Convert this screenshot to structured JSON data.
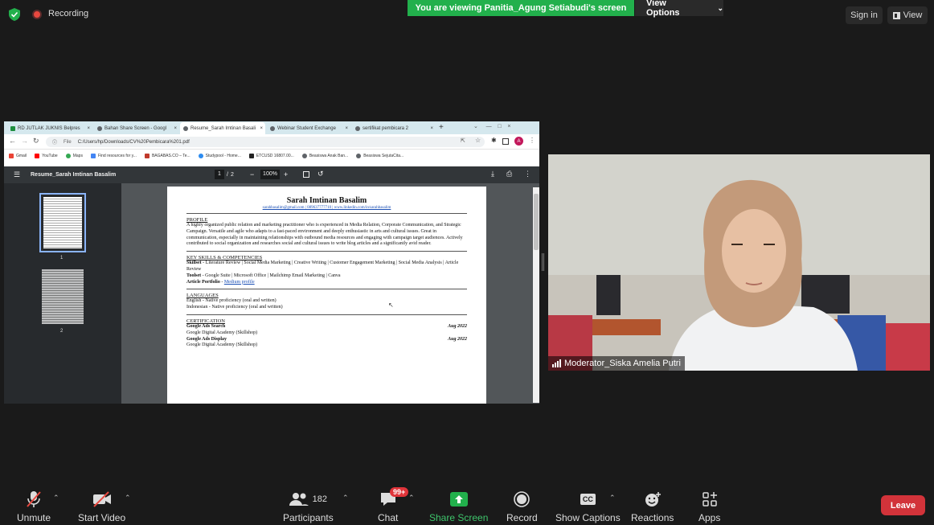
{
  "top": {
    "recording_label": "Recording",
    "viewing_banner": "You are viewing Panitia_Agung Setiabudi's screen",
    "view_options_label": "View Options",
    "sign_in_label": "Sign in",
    "view_label": "View"
  },
  "browser": {
    "tabs": [
      {
        "label": "RD JUTLAK JUKNIS Belpres",
        "color": "#1e8e3e"
      },
      {
        "label": "Bahan Share Screen - Googl",
        "color": "#5f6368"
      },
      {
        "label": "Resume_Sarah Imtinan Basali",
        "color": "#5f6368"
      },
      {
        "label": "Webinar Student Exchange",
        "color": "#5f6368"
      },
      {
        "label": "sertifikat pembicara 2",
        "color": "#5f6368"
      }
    ],
    "new_tab": "+",
    "file_label": "File",
    "url": "C:/Users/hp/Downloads/CV%20Pembicara%201.pdf",
    "profile_initial": "A",
    "bookmarks": [
      {
        "label": "Gmail",
        "color": "#ea4335"
      },
      {
        "label": "YouTube",
        "color": "#ff0000"
      },
      {
        "label": "Maps",
        "color": "#34a853"
      },
      {
        "label": "Find resources for y...",
        "color": "#4285f4"
      },
      {
        "label": "BAGABAS.CO – Te...",
        "color": "#c0392b"
      },
      {
        "label": "Studypool - Home...",
        "color": "#2d8cf0"
      },
      {
        "label": "ETCUSD 16807.00...",
        "color": "#222222"
      },
      {
        "label": "Beasiswa Anak Ban...",
        "color": "#5f6368"
      },
      {
        "label": "Beasiswa SejutaCita...",
        "color": "#5f6368"
      }
    ]
  },
  "pdf": {
    "title": "Resume_Sarah Imtinan Basalim",
    "page_current": "1",
    "page_sep": "/",
    "page_total": "2",
    "zoom": "100%",
    "thumb1_label": "1",
    "thumb2_label": "2"
  },
  "resume": {
    "name": "Sarah Imtinan Basalim",
    "contact": "sarahbasalim@gmail.com | 089637777710 | www.linkedin.com/in/sarahbasalim",
    "profile_heading": "PROFILE",
    "profile_text": "A highly organized public relation and marketing practitioner who is experienced in Media Relation, Corporate Communication, and Strategic Campaign. Versatile and agile who adapts to a fast-paced environment and deeply enthusiastic in arts and cultural issues. Great in communication, especially in maintaining relationships with outbound media resources and engaging with campaign target audiences. Actively contributed to social organization and researches social and cultural issues to write blog articles and a significantly avid reader.",
    "skills_heading": "KEY SKILLS & COMPETENCIES",
    "skillset_label": "Skillset",
    "skillset_text": " - Literature Review | Social Media Marketing | Creative Writing | Customer Engagement Marketing | Social Media Analysis | Article Review",
    "toolset_label": "Toolset",
    "toolset_text": " - Google Suite | Microsoft Office | Mailchimp Email Marketing | Canva",
    "portfolio_label": "Article Portfolio",
    "portfolio_sep": " - ",
    "portfolio_link": "Medium profile",
    "languages_heading": "LANGUAGES",
    "lang1": "English - Native proficiency (oral and written)",
    "lang2": "Indonesian - Native proficiency (oral and written)",
    "cert_heading": "CERTIFICATION",
    "cert1_title": "Google Ads Search",
    "cert1_date": "Aug 2022",
    "cert1_org": "Google Digital Academy (Skillshop)",
    "cert2_title": "Google Ads Display",
    "cert2_date": "Aug 2022",
    "cert2_org": "Google Digital Academy (Skillshop)"
  },
  "video": {
    "participant_label": "Moderator_Siska Amelia Putri"
  },
  "toolbar": {
    "unmute": "Unmute",
    "start_video": "Start Video",
    "participants": "Participants",
    "participants_count": "182",
    "chat": "Chat",
    "chat_badge": "99+",
    "share_screen": "Share Screen",
    "record": "Record",
    "show_captions": "Show Captions",
    "cc": "CC",
    "reactions": "Reactions",
    "apps": "Apps",
    "leave": "Leave"
  },
  "colors": {
    "share_green": "#22b04c",
    "leave_red": "#d2333a",
    "record_red": "#e8483f"
  }
}
